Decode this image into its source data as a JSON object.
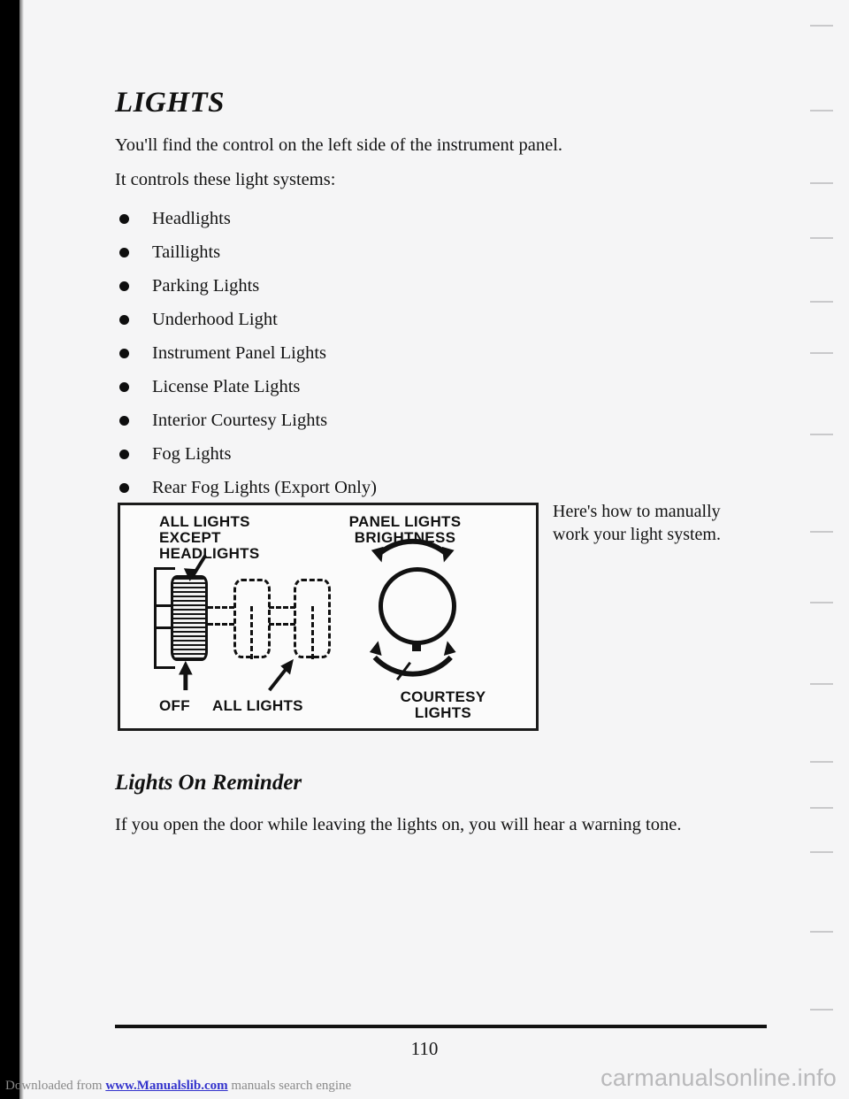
{
  "page": {
    "number": "110",
    "background_color": "#f5f5f6"
  },
  "section": {
    "title": "LIGHTS",
    "intro_line_1": "You'll find the control on the left side of the instrument panel.",
    "intro_line_2": "It controls these light systems:",
    "items": [
      "Headlights",
      "Taillights",
      "Parking Lights",
      "Underhood Light",
      "Instrument Panel Lights",
      "License Plate Lights",
      "Interior Courtesy Lights",
      "Fog Lights",
      "Rear Fog Lights (Export Only)"
    ]
  },
  "diagram": {
    "label_all_except_headlights": "ALL LIGHTS\nEXCEPT\nHEADLIGHTS",
    "label_panel_brightness": "PANEL LIGHTS\nBRIGHTNESS",
    "label_off": "OFF",
    "label_all_lights": "ALL LIGHTS",
    "label_courtesy_lights": "COURTESY\nLIGHTS"
  },
  "side_note": {
    "text": "Here's how to manually work your light system."
  },
  "subsection": {
    "title": "Lights On Reminder",
    "body": "If you open the door while leaving the lights on, you will hear a warning tone."
  },
  "footer": {
    "download_prefix": "Downloaded from ",
    "download_link": "www.Manualslib.com",
    "download_suffix": "  manuals search engine",
    "watermark": "carmanualsonline.info"
  }
}
